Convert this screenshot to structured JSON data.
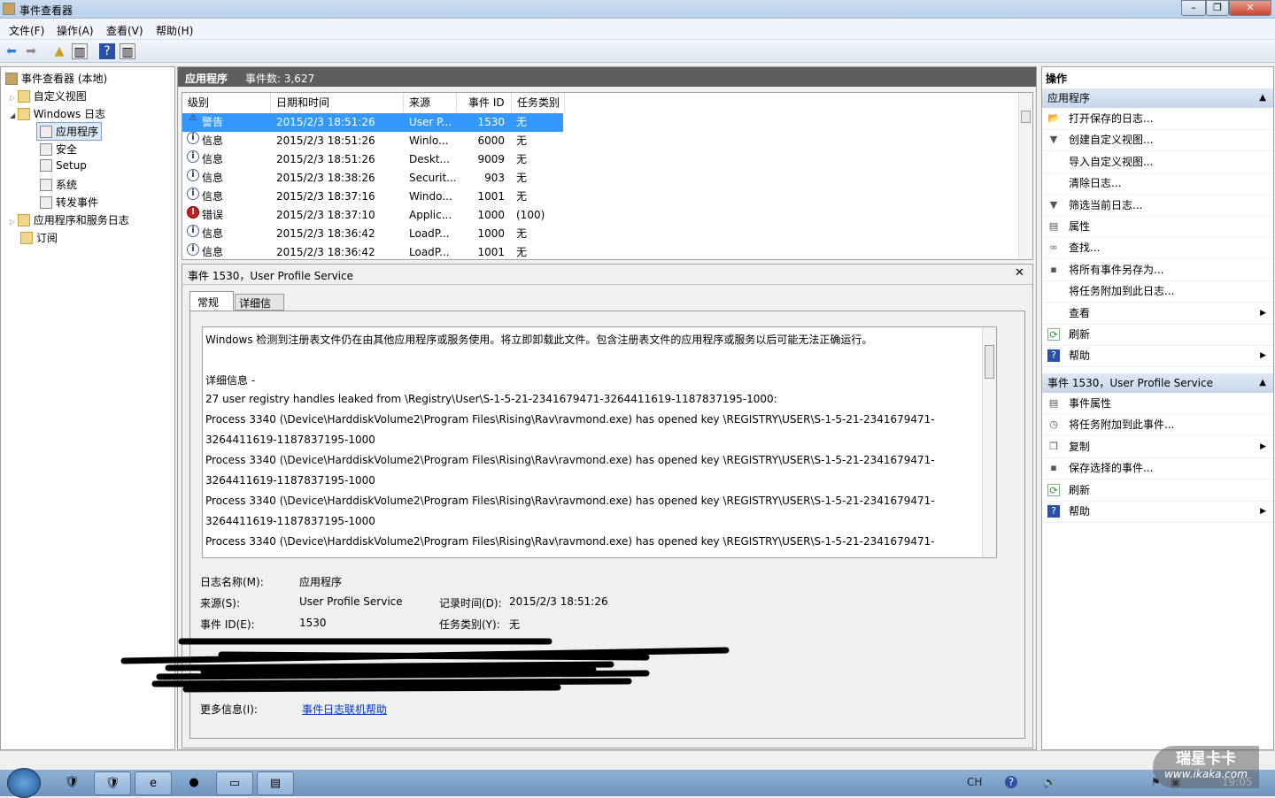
{
  "window": {
    "title": "事件查看器"
  },
  "menu": [
    "文件(F)",
    "操作(A)",
    "查看(V)",
    "帮助(H)"
  ],
  "tree": [
    {
      "label": "事件查看器 (本地)"
    },
    {
      "label": "自定义视图"
    },
    {
      "label": "Windows 日志"
    },
    {
      "label": "应用程序",
      "selected": true
    },
    {
      "label": "安全"
    },
    {
      "label": "Setup"
    },
    {
      "label": "系统"
    },
    {
      "label": "转发事件"
    },
    {
      "label": "应用程序和服务日志"
    },
    {
      "label": "订阅"
    }
  ],
  "center": {
    "log_name": "应用程序",
    "event_count": "事件数: 3,627"
  },
  "table": {
    "columns": [
      "级别",
      "日期和时间",
      "来源",
      "事件 ID",
      "任务类别"
    ],
    "rows": [
      {
        "level": "警告",
        "icon": "warning-icon",
        "datetime": "2015/2/3 18:51:26",
        "source": "User P...",
        "id": "1530",
        "task": "无",
        "selected": true
      },
      {
        "level": "信息",
        "icon": "info-icon",
        "datetime": "2015/2/3 18:51:26",
        "source": "Winlo...",
        "id": "6000",
        "task": "无"
      },
      {
        "level": "信息",
        "icon": "info-icon",
        "datetime": "2015/2/3 18:51:26",
        "source": "Deskt...",
        "id": "9009",
        "task": "无"
      },
      {
        "level": "信息",
        "icon": "info-icon",
        "datetime": "2015/2/3 18:38:26",
        "source": "Securit...",
        "id": "903",
        "task": "无"
      },
      {
        "level": "信息",
        "icon": "info-icon",
        "datetime": "2015/2/3 18:37:16",
        "source": "Windo...",
        "id": "1001",
        "task": "无"
      },
      {
        "level": "错误",
        "icon": "error-icon",
        "datetime": "2015/2/3 18:37:10",
        "source": "Applic...",
        "id": "1000",
        "task": "(100)"
      },
      {
        "level": "信息",
        "icon": "info-icon",
        "datetime": "2015/2/3 18:36:42",
        "source": "LoadP...",
        "id": "1000",
        "task": "无"
      },
      {
        "level": "信息",
        "icon": "info-icon",
        "datetime": "2015/2/3 18:36:42",
        "source": "LoadP...",
        "id": "1001",
        "task": "无"
      }
    ]
  },
  "detail": {
    "title": "事件 1530，User Profile Service",
    "tabs": [
      "常规",
      "详细信息"
    ],
    "message": [
      "Windows 检测到注册表文件仍在由其他应用程序或服务使用。将立即卸载此文件。包含注册表文件的应用程序或服务以后可能无法正确运行。",
      "",
      " 详细信息 -",
      " 27 user registry handles leaked from \\Registry\\User\\S-1-5-21-2341679471-3264411619-1187837195-1000:",
      "Process 3340 (\\Device\\HarddiskVolume2\\Program Files\\Rising\\Rav\\ravmond.exe) has opened key \\REGISTRY\\USER\\S-1-5-21-2341679471-",
      "3264411619-1187837195-1000",
      "Process 3340 (\\Device\\HarddiskVolume2\\Program Files\\Rising\\Rav\\ravmond.exe) has opened key \\REGISTRY\\USER\\S-1-5-21-2341679471-",
      "3264411619-1187837195-1000",
      "Process 3340 (\\Device\\HarddiskVolume2\\Program Files\\Rising\\Rav\\ravmond.exe) has opened key \\REGISTRY\\USER\\S-1-5-21-2341679471-",
      "3264411619-1187837195-1000",
      "Process 3340 (\\Device\\HarddiskVolume2\\Program Files\\Rising\\Rav\\ravmond.exe) has opened key \\REGISTRY\\USER\\S-1-5-21-2341679471-"
    ],
    "fields": {
      "log_name_label": "日志名称(M):",
      "log_name": "应用程序",
      "source_label": "来源(S):",
      "source": "User Profile Service",
      "logged_label": "记录时间(D):",
      "logged": "2015/2/3 18:51:26",
      "event_id_label": "事件 ID(E):",
      "event_id": "1530",
      "task_label": "任务类别(Y):",
      "task": "无",
      "more_info_label": "更多信息(I):",
      "more_info_link": "事件日志联机帮助"
    }
  },
  "actions": {
    "title": "操作",
    "section1": {
      "title": "应用程序",
      "items": [
        {
          "label": "打开保存的日志...",
          "icon": "folder-open-icon"
        },
        {
          "label": "创建自定义视图...",
          "icon": "filter-icon"
        },
        {
          "label": "导入自定义视图...",
          "icon": ""
        },
        {
          "label": "清除日志...",
          "icon": ""
        },
        {
          "label": "筛选当前日志...",
          "icon": "filter-icon"
        },
        {
          "label": "属性",
          "icon": "properties-icon"
        },
        {
          "label": "查找...",
          "icon": "binoculars-icon"
        },
        {
          "label": "将所有事件另存为...",
          "icon": "save-icon"
        },
        {
          "label": "将任务附加到此日志...",
          "icon": ""
        },
        {
          "label": "查看",
          "icon": "",
          "submenu": true
        },
        {
          "label": "刷新",
          "icon": "refresh-icon"
        },
        {
          "label": "帮助",
          "icon": "help-icon",
          "submenu": true
        }
      ]
    },
    "section2": {
      "title": "事件 1530，User Profile Service",
      "items": [
        {
          "label": "事件属性",
          "icon": "properties-icon"
        },
        {
          "label": "将任务附加到此事件...",
          "icon": "task-icon"
        },
        {
          "label": "复制",
          "icon": "copy-icon",
          "submenu": true
        },
        {
          "label": "保存选择的事件...",
          "icon": "save-icon"
        },
        {
          "label": "刷新",
          "icon": "refresh-icon"
        },
        {
          "label": "帮助",
          "icon": "help-icon",
          "submenu": true
        }
      ]
    }
  },
  "taskbar": {
    "lang": "CH",
    "clock": "19:05"
  },
  "watermark": {
    "text": "瑞星卡卡",
    "url": "www.ikaka.com"
  }
}
